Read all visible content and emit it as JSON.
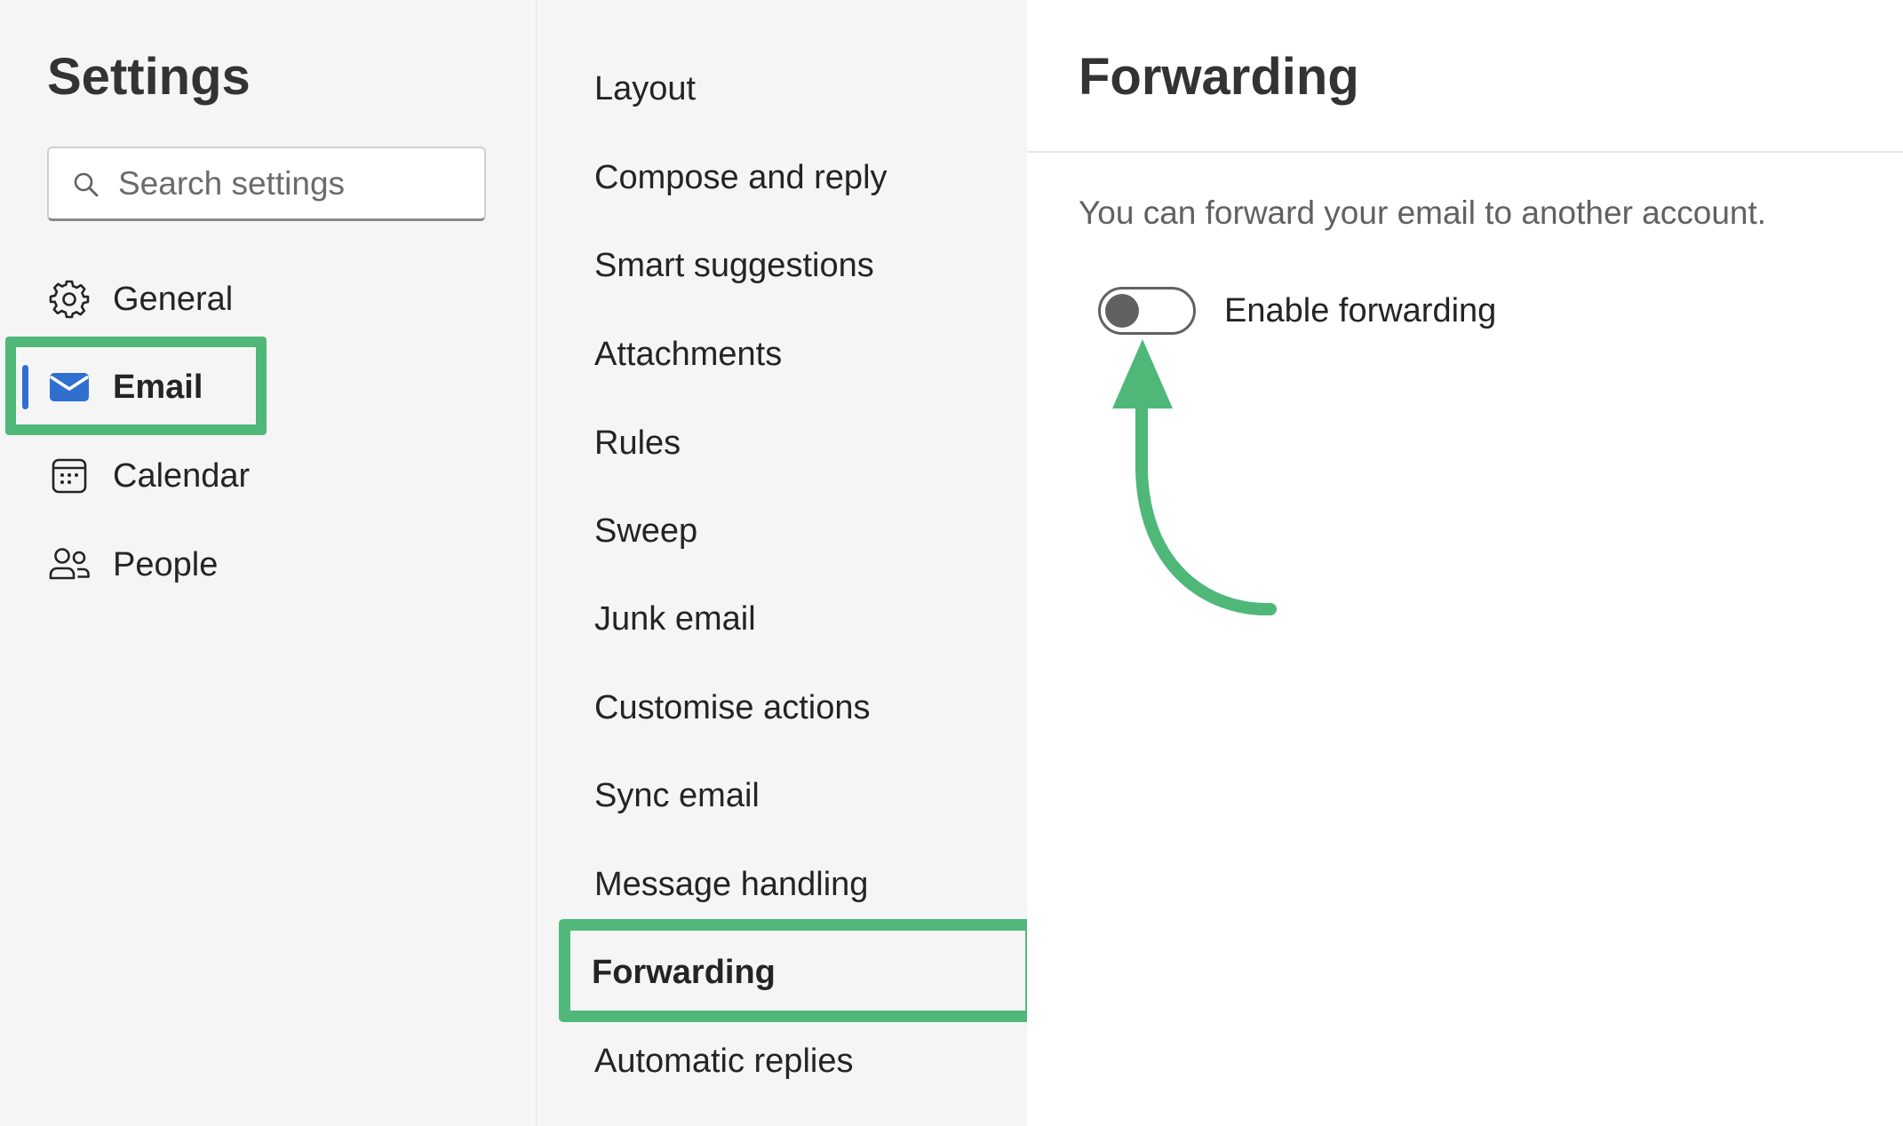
{
  "sidebar": {
    "title": "Settings",
    "search": {
      "placeholder": "Search settings",
      "value": "",
      "icon": "search-icon"
    },
    "items": [
      {
        "label": "General",
        "icon": "gear-icon",
        "selected": false
      },
      {
        "label": "Email",
        "icon": "mail-icon",
        "selected": true
      },
      {
        "label": "Calendar",
        "icon": "calendar-icon",
        "selected": false
      },
      {
        "label": "People",
        "icon": "people-icon",
        "selected": false
      }
    ]
  },
  "submenu": {
    "items": [
      {
        "label": "Layout",
        "selected": false
      },
      {
        "label": "Compose and reply",
        "selected": false
      },
      {
        "label": "Smart suggestions",
        "selected": false
      },
      {
        "label": "Attachments",
        "selected": false
      },
      {
        "label": "Rules",
        "selected": false
      },
      {
        "label": "Sweep",
        "selected": false
      },
      {
        "label": "Junk email",
        "selected": false
      },
      {
        "label": "Customise actions",
        "selected": false
      },
      {
        "label": "Sync email",
        "selected": false
      },
      {
        "label": "Message handling",
        "selected": false
      },
      {
        "label": "Forwarding",
        "selected": true
      },
      {
        "label": "Automatic replies",
        "selected": false
      }
    ]
  },
  "panel": {
    "title": "Forwarding",
    "description": "You can forward your email to another account.",
    "toggle": {
      "label": "Enable forwarding",
      "enabled": false
    }
  },
  "colors": {
    "highlight": "#4fb879",
    "accent": "#2f6fd0",
    "background_nav": "#f5f5f5",
    "background_panel": "#ffffff"
  }
}
